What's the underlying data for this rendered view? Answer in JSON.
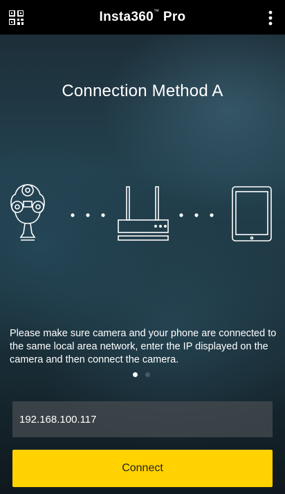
{
  "header": {
    "title": "Insta360",
    "trademark": "™",
    "subtitle": "Pro",
    "left_icon": "qr-code-icon",
    "right_icon": "more-vertical-icon"
  },
  "main": {
    "heading": "Connection Method A",
    "diagram_items": [
      "camera-icon",
      "router-icon",
      "tablet-icon"
    ],
    "description": "Please make sure camera and your phone are connected to the same local area network, enter the IP displayed on the camera and then connect the camera.",
    "pager": {
      "active_page": 1,
      "total_pages": 2
    }
  },
  "form": {
    "ip_value": "192.168.100.117",
    "connect_label": "Connect"
  },
  "colors": {
    "accent": "#ffd200",
    "topbar": "#000000"
  }
}
